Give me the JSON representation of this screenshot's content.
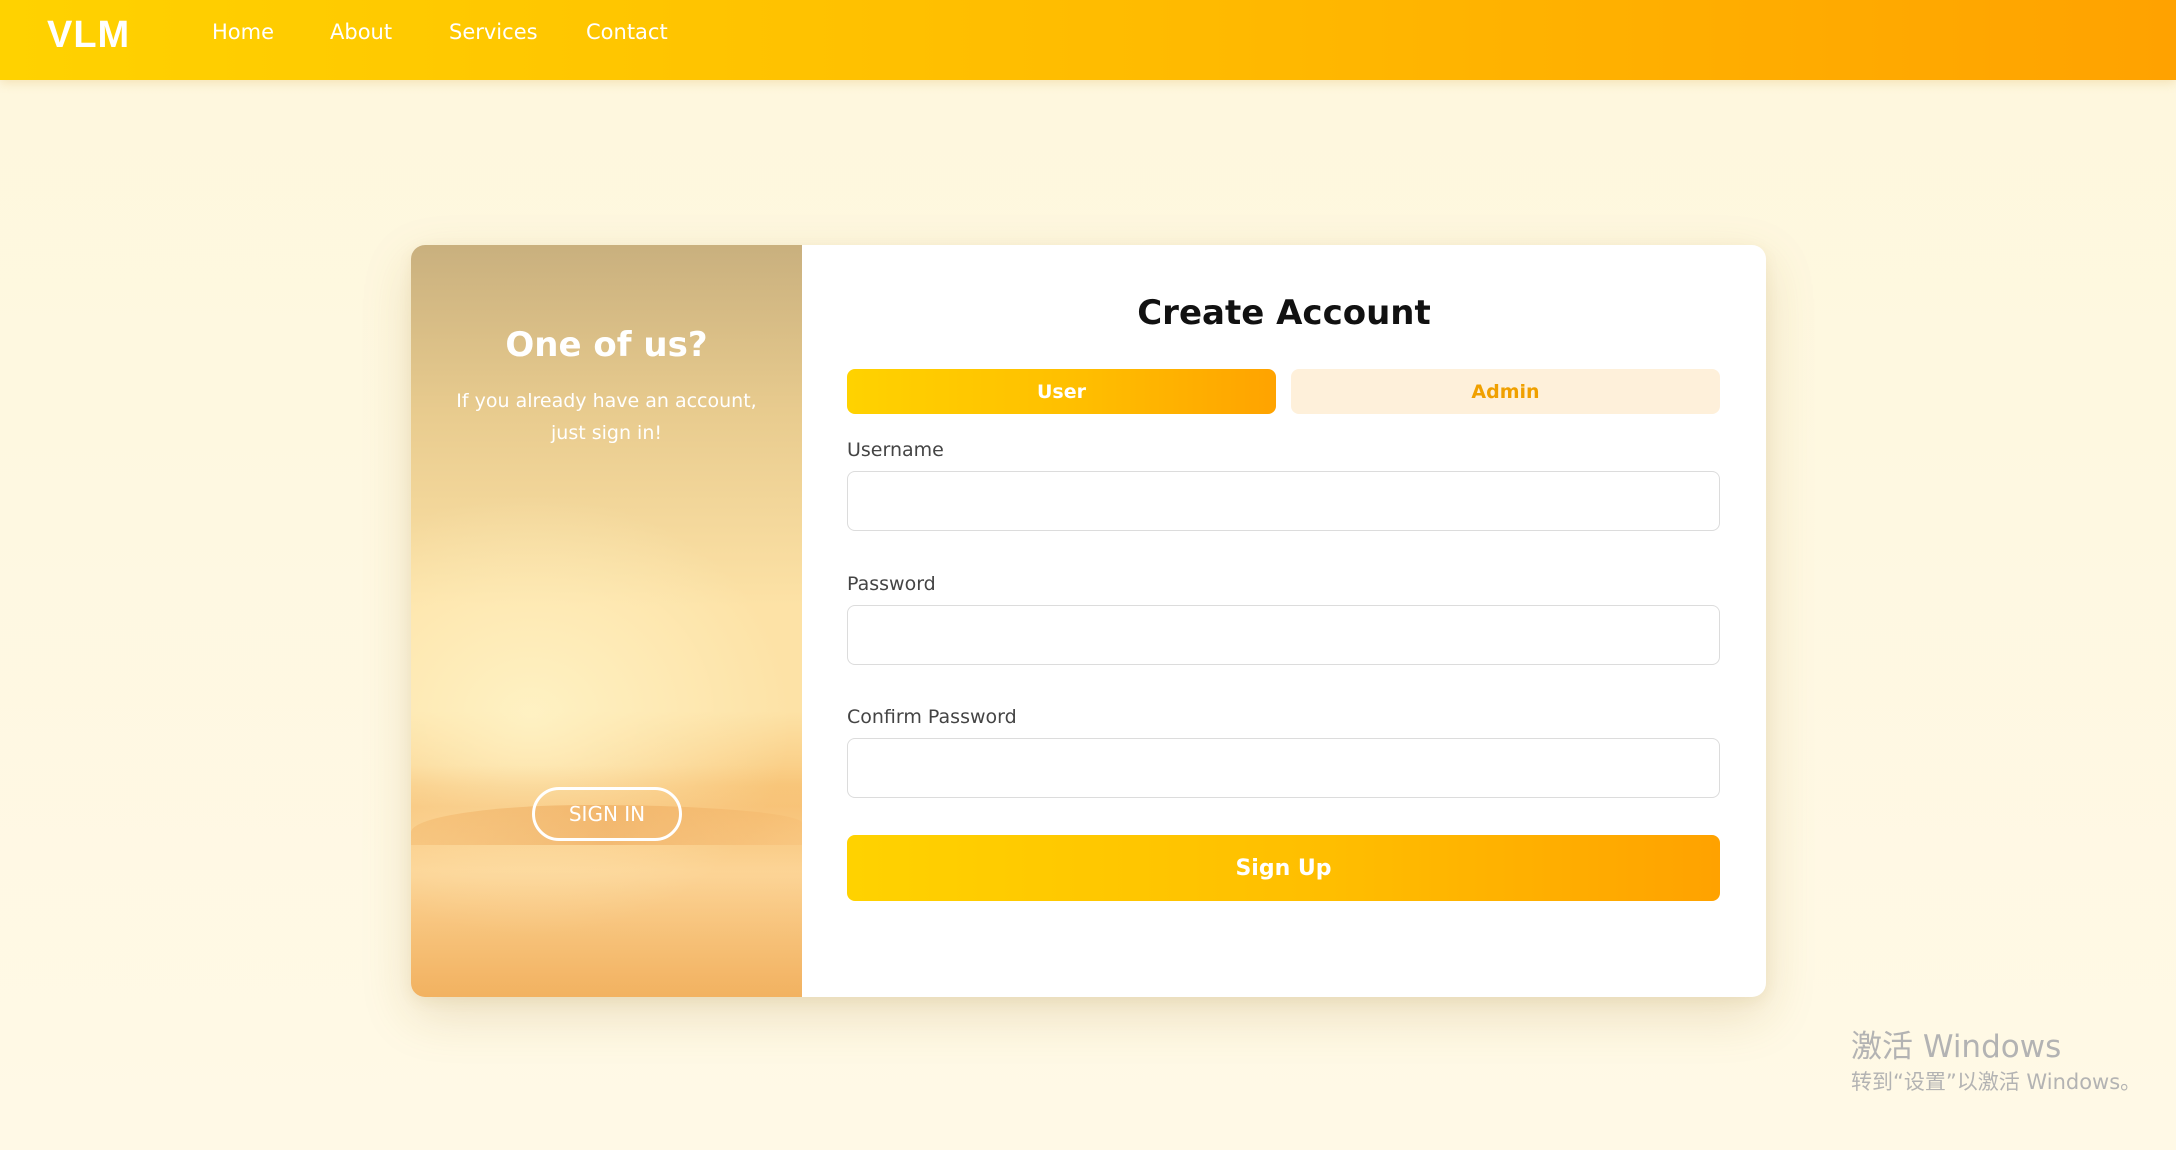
{
  "navbar": {
    "brand": "VLM",
    "links": [
      "Home",
      "About",
      "Services",
      "Contact"
    ]
  },
  "side_panel": {
    "title": "One of us?",
    "text": "If you already have an account, just sign in!",
    "button_label": "SIGN IN"
  },
  "form": {
    "title": "Create Account",
    "roles": [
      "User",
      "Admin"
    ],
    "selected_role": "User",
    "fields": [
      {
        "label": "Username",
        "value": ""
      },
      {
        "label": "Password",
        "value": ""
      },
      {
        "label": "Confirm Password",
        "value": ""
      }
    ],
    "submit_label": "Sign Up"
  },
  "watermark": {
    "line1": "激活 Windows",
    "line2": "转到“设置”以激活 Windows。"
  },
  "colors": {
    "accent_start": "#ffd200",
    "accent_end": "#ffa200",
    "admin_tab_bg": "#fef0da",
    "admin_tab_text": "#f0a000",
    "page_bg": "#fef8e2"
  }
}
